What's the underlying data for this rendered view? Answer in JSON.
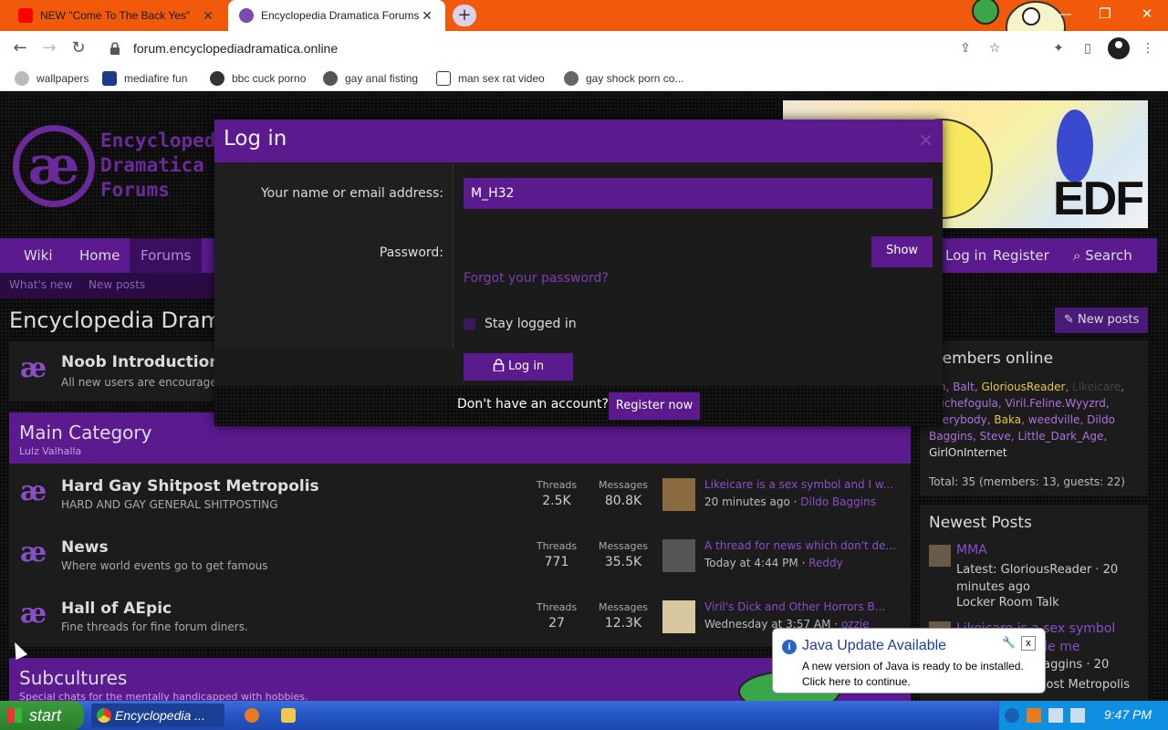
{
  "browser": {
    "tabs": [
      {
        "title": "NEW \"Come To The Back Yes\"",
        "favicon": "youtube-icon",
        "color": "#ff0000"
      },
      {
        "title": "Encyclopedia Dramatica Forums",
        "favicon": "forum-icon",
        "color": "#7a4ab0"
      }
    ],
    "new_tab_label": "+",
    "url": "forum.encyclopediadramatica.online",
    "bookmarks": [
      {
        "label": "wallpapers",
        "icon": "gear-icon"
      },
      {
        "label": "mediafire fun",
        "icon": "mediafire-icon"
      },
      {
        "label": "bbc cuck porno",
        "icon": "globe-icon"
      },
      {
        "label": "gay anal fisting",
        "icon": "firefox-icon"
      },
      {
        "label": "man sex rat video",
        "icon": "sigma-icon"
      },
      {
        "label": "gay shock porn co...",
        "icon": "skull-icon"
      }
    ]
  },
  "site": {
    "logo_glyph": "æ",
    "logo_lines": [
      "Encyclopedia",
      "Dramatica",
      "Forums"
    ],
    "banner_text": "EDF",
    "nav": [
      "Wiki",
      "Home",
      "Forums"
    ],
    "nav_right": [
      "Log in",
      "Register",
      "Search"
    ],
    "subnav": [
      "What's new",
      "New posts"
    ],
    "page_title": "Encyclopedia Dramatica",
    "new_posts_btn": "New posts"
  },
  "nodes": {
    "noob": {
      "title": "Noob Introduction",
      "desc": "All new users are encouraged"
    },
    "main_category": {
      "title": "Main Category",
      "desc": "Lulz Valhalla"
    },
    "forums": [
      {
        "title": "Hard Gay Shitpost Metropolis",
        "desc": "HARD AND GAY GENERAL SHITPOSTING",
        "threads": "2.5K",
        "messages": "80.8K",
        "last_title": "Likeicare is a sex symbol and I w...",
        "last_time": "20 minutes ago",
        "last_user": "Dildo Baggins"
      },
      {
        "title": "News",
        "desc": "Where world events go to get famous",
        "threads": "771",
        "messages": "35.5K",
        "last_title": "A thread for news which don't de...",
        "last_time": "Today at 4:44 PM",
        "last_user": "Reddy"
      },
      {
        "title": "Hall of AEpic",
        "desc": "Fine threads for fine forum diners.",
        "threads": "27",
        "messages": "12.3K",
        "last_title": "Viril's Dick and Other Horrors B...",
        "last_time": "Wednesday at 3:57 AM",
        "last_user": "ozzie"
      }
    ],
    "threads_label": "Threads",
    "messages_label": "Messages",
    "subcultures": {
      "title": "Subcultures",
      "desc": "Special chats for the mentally handicapped with hobbies."
    }
  },
  "sidebar": {
    "members_title": "Members online",
    "members": [
      {
        "name": "Jim",
        "color": "purple"
      },
      {
        "name": "Balt",
        "color": "purple"
      },
      {
        "name": "GloriousReader",
        "color": "gold"
      },
      {
        "name": "Likeicare",
        "color": "purple"
      },
      {
        "name": "Duchefogula",
        "color": "purple"
      },
      {
        "name": "Viril.Feline.Wyyzrd",
        "color": "purple"
      },
      {
        "name": "Everybody",
        "color": "purple"
      },
      {
        "name": "Baka",
        "color": "gold"
      },
      {
        "name": "weedville",
        "color": "purple"
      },
      {
        "name": "Dildo Baggins",
        "color": "purple"
      },
      {
        "name": "Steve",
        "color": "purple"
      },
      {
        "name": "Little_Dark_Age",
        "color": "purple"
      },
      {
        "name": "GirlOnInternet",
        "color": "white"
      }
    ],
    "total": "Total: 35 (members: 13, guests: 22)",
    "newest_title": "Newest Posts",
    "newest": [
      {
        "title": "MMA",
        "meta": "Latest: GloriousReader · 20 minutes ago",
        "forum": "Locker Room Talk"
      },
      {
        "title": "Likeicare is a sex symbol and I w... inside me",
        "meta": "Latest: Dildo Baggins · 20",
        "forum": "Hard Gay Shitpost Metropolis"
      }
    ]
  },
  "modal": {
    "title": "Log in",
    "close": "×",
    "name_label": "Your name or email address:",
    "name_value": "M_H32",
    "password_label": "Password:",
    "password_value": "",
    "show": "Show",
    "forgot": "Forgot your password?",
    "stay": "Stay logged in",
    "login": "Log in",
    "no_account": "Don't have an account?",
    "register": "Register now"
  },
  "java": {
    "title": "Java Update Available",
    "line1": "A new version of Java is ready to be installed.",
    "line2": "Click here to continue.",
    "close": "x"
  },
  "taskbar": {
    "start": "start",
    "task": "Encyclopedia ...",
    "clock": "9:47 PM"
  }
}
